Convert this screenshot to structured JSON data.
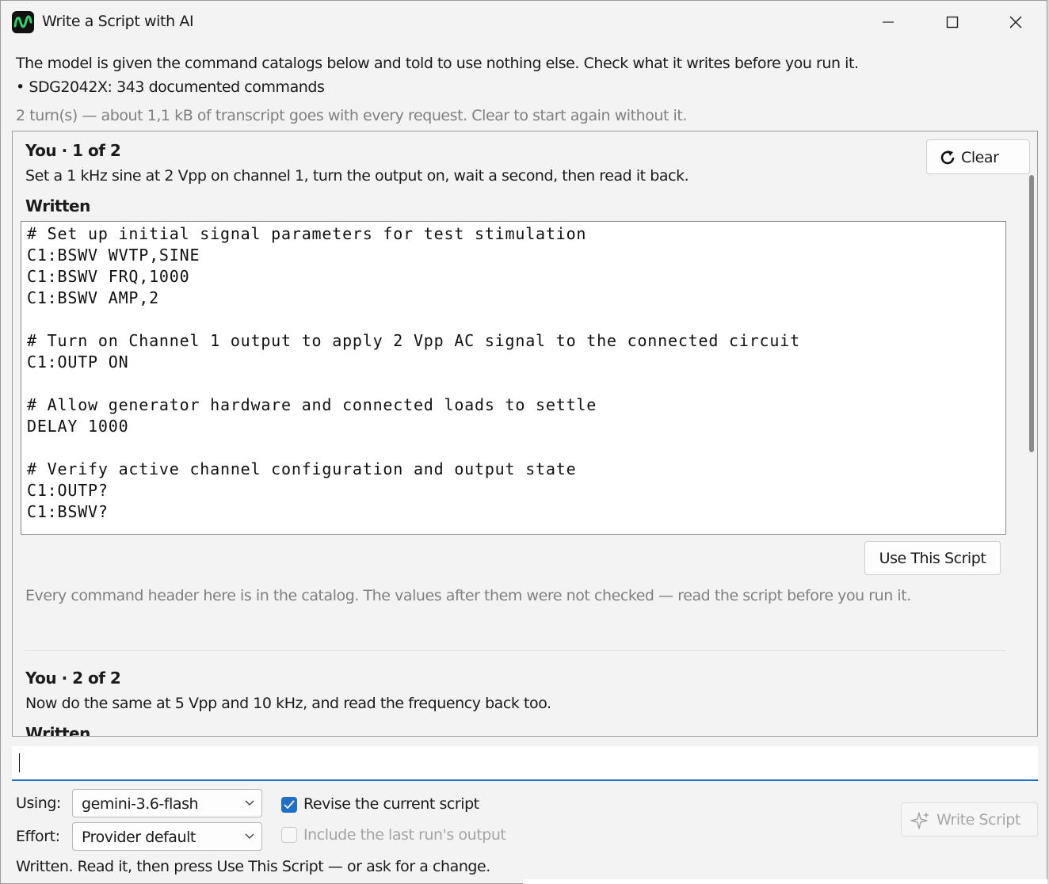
{
  "window": {
    "title": "Write a Script with AI"
  },
  "info": {
    "line1": "The model is given the command catalogs below and told to use nothing else. Check what it writes before you run it.",
    "catalog_line": "• SDG2042X: 343 documented commands",
    "transcript_note": "2 turn(s) — about 1,1 kB of transcript goes with every request. Clear to start again without it."
  },
  "turns": [
    {
      "head": "You · 1 of 2",
      "prompt": "Set a 1 kHz sine at 2 Vpp on channel 1, turn the output on, wait a second, then read it back.",
      "written_label": "Written",
      "code": [
        "# Set up initial signal parameters for test stimulation",
        "C1:BSWV WVTP,SINE",
        "C1:BSWV FRQ,1000",
        "C1:BSWV AMP,2",
        "",
        "# Turn on Channel 1 output to apply 2 Vpp AC signal to the connected circuit",
        "C1:OUTP ON",
        "",
        "# Allow generator hardware and connected loads to settle",
        "DELAY 1000",
        "",
        "# Verify active channel configuration and output state",
        "C1:OUTP?",
        "C1:BSWV?"
      ],
      "use_label": "Use This Script",
      "note": "Every command header here is in the catalog. The values after them were not checked — read the script before you run it."
    },
    {
      "head": "You · 2 of 2",
      "prompt": "Now do the same at 5 Vpp and 10 kHz, and read the frequency back too.",
      "written_label": "Written"
    }
  ],
  "clear_label": "Clear",
  "prompt_input": {
    "value": "",
    "placeholder": ""
  },
  "controls": {
    "using_label": "Using:",
    "using_value": "gemini-3.6-flash",
    "effort_label": "Effort:",
    "effort_value": "Provider default",
    "revise_label": "Revise the current script",
    "revise_checked": true,
    "include_label": "Include the last run's output",
    "include_checked": false,
    "write_label": "Write Script"
  },
  "status": "Written. Read it, then press Use This Script — or ask for a change.",
  "colors": {
    "accent": "#1f6fc5",
    "muted": "#808080",
    "disabled": "#a6a6a6",
    "logo": "#2fd16a"
  }
}
